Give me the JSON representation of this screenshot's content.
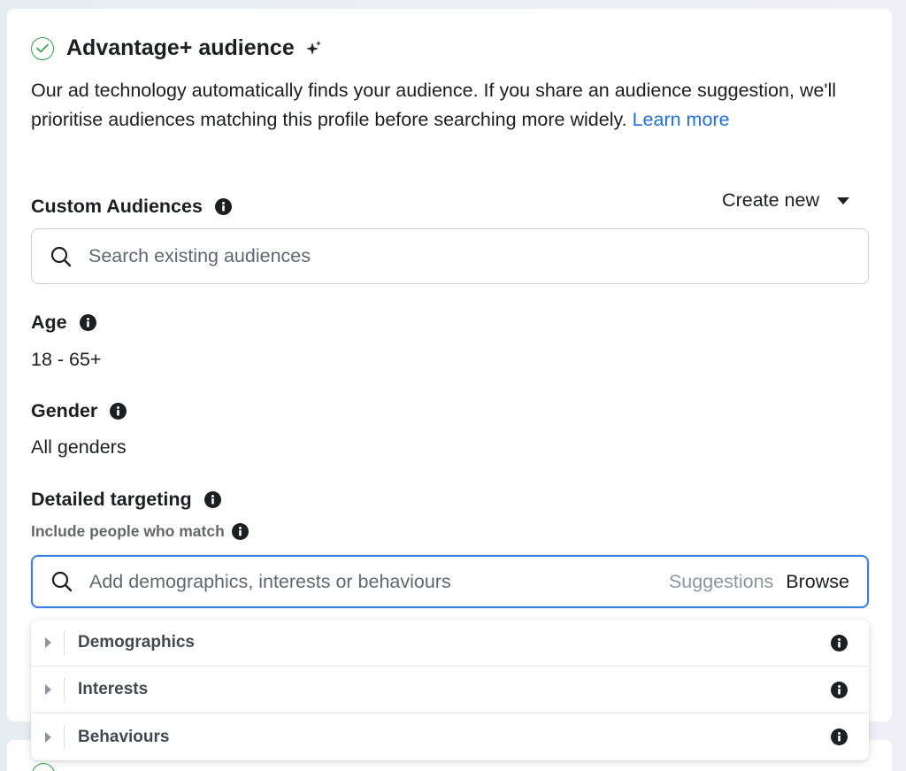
{
  "section": {
    "title": "Advantage+ audience",
    "description": "Our ad technology automatically finds your audience. If you share an audience suggestion, we'll prioritise audiences matching this profile before searching more widely.",
    "learn_more": "Learn more"
  },
  "custom_audiences": {
    "label": "Custom Audiences",
    "create_new": "Create new",
    "search_placeholder": "Search existing audiences"
  },
  "age": {
    "label": "Age",
    "value": "18 - 65+"
  },
  "gender": {
    "label": "Gender",
    "value": "All genders"
  },
  "detailed_targeting": {
    "label": "Detailed targeting",
    "sublabel": "Include people who match",
    "search_placeholder": "Add demographics, interests or behaviours",
    "suggestions": "Suggestions",
    "browse": "Browse",
    "categories": [
      {
        "label": "Demographics"
      },
      {
        "label": "Interests"
      },
      {
        "label": "Behaviours"
      }
    ]
  },
  "colors": {
    "accent_blue": "#216fdb",
    "focus_border": "#3b82e0",
    "check_green": "#31a24c"
  }
}
